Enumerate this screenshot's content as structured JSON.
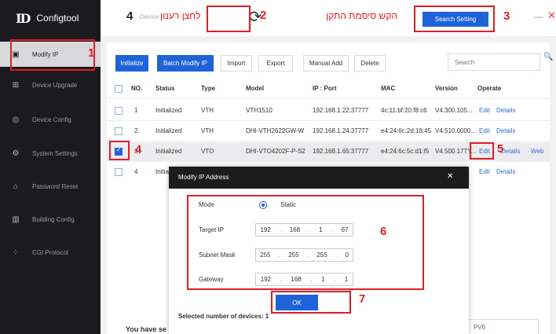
{
  "app": {
    "title": "Configtool",
    "logo_mark": "ID"
  },
  "sidebar": {
    "items": [
      {
        "label": "Modify IP",
        "icon": "modify-ip-icon",
        "glyph": "▣"
      },
      {
        "label": "Device Upgrade",
        "icon": "upgrade-icon",
        "glyph": "⊞"
      },
      {
        "label": "Device Config",
        "icon": "config-icon",
        "glyph": "◎"
      },
      {
        "label": "System Settings",
        "icon": "settings-icon",
        "glyph": "⚙"
      },
      {
        "label": "Password Reset",
        "icon": "lock-icon",
        "glyph": "⌂"
      },
      {
        "label": "Building Config",
        "icon": "building-icon",
        "glyph": "▥"
      },
      {
        "label": "CGI Protocol",
        "icon": "cgi-icon",
        "glyph": "⁘"
      }
    ]
  },
  "topbar": {
    "device_tab": "Device",
    "search_setting_label": "Search Setting",
    "minimize": "—",
    "close": "✕",
    "refresh": "⟳"
  },
  "toolbar": {
    "initialize": "Initialize",
    "batch_modify_ip": "Batch Modify IP",
    "import": "Import",
    "export": "Export",
    "manual_add": "Manual Add",
    "delete": "Delete",
    "search_placeholder": "Search"
  },
  "table": {
    "headers": {
      "no": "NO.",
      "status": "Status",
      "type": "Type",
      "model": "Model",
      "ip_port": "IP : Port",
      "mac": "MAC",
      "version": "Version",
      "operate": "Operate"
    },
    "rows": [
      {
        "no": "1",
        "status": "Initialized",
        "type": "VTH",
        "model": "VTH1510",
        "ip_port": "192.168.1.22:37777",
        "mac": "4c:11:bf:20:f8:c6",
        "version": "V4.300.105...",
        "edit": "Edit",
        "details": "Details",
        "web": ""
      },
      {
        "no": "2",
        "status": "Initialized",
        "type": "VTH",
        "model": "DHI-VTH2622GW-W",
        "ip_port": "192.168.1.24:37777",
        "mac": "e4:24:6c:2d:18:45",
        "version": "V4.510.0000...",
        "edit": "Edit",
        "details": "Details",
        "web": ""
      },
      {
        "no": "3",
        "status": "Initialized",
        "type": "VTO",
        "model": "DHI-VTO4202F-P-S2",
        "ip_port": "192.168.1.65:37777",
        "mac": "e4:24:6c:5c:d1:f5",
        "version": "V4.500.17TY...",
        "edit": "Edit",
        "details": "Details",
        "web": "Web"
      },
      {
        "no": "4",
        "status": "Initia",
        "type": "",
        "model": "",
        "ip_port": "",
        "mac": "",
        "version": "",
        "edit": "Edit",
        "details": "Details",
        "web": ""
      }
    ]
  },
  "bottom": {
    "text": "You have se",
    "field": "PV6"
  },
  "modal": {
    "title": "Modify IP Address",
    "close": "✕",
    "mode_label": "Mode",
    "mode_value": "Static",
    "target_ip_label": "Target IP",
    "target_ip": [
      "192",
      "168",
      "1",
      "67"
    ],
    "subnet_label": "Subnet Mask",
    "subnet": [
      "255",
      "255",
      "255",
      "0"
    ],
    "gateway_label": "Gateway",
    "gateway": [
      "192",
      "168",
      "1",
      "1"
    ],
    "ok_label": "OK",
    "footer": "Selected number of devices: 1"
  },
  "annotations": {
    "n1": "1",
    "n2": "2",
    "n3": "3",
    "n4_top": "4",
    "n4_row": "4",
    "n5": "5",
    "n6": "6",
    "n7": "7",
    "hebrew_refresh": "לחצן רענון",
    "hebrew_search": "הקש סיסמת התקן",
    "color": "#e01e2a"
  }
}
